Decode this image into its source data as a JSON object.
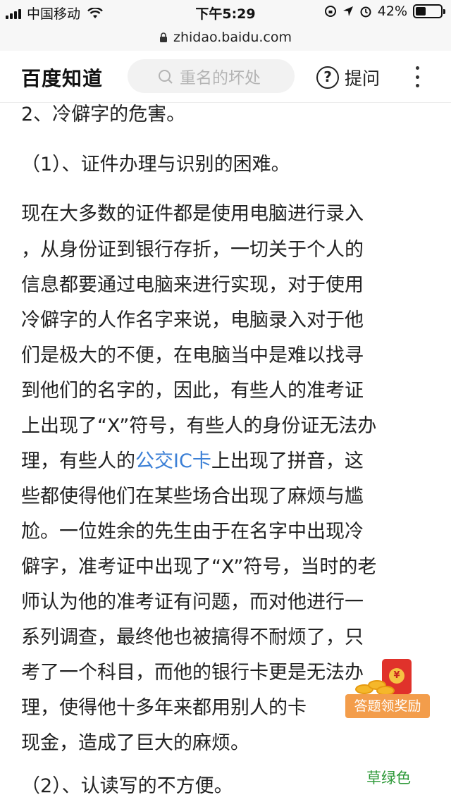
{
  "status_bar": {
    "carrier": "中国移动",
    "time": "下午5:29",
    "battery": "42%",
    "battery_level": 0.42
  },
  "url_bar": {
    "url": "zhidao.baidu.com"
  },
  "header": {
    "logo": "百度知道",
    "search_text": "重名的坏处",
    "ask_label": "提问",
    "ask_glyph": "?"
  },
  "content": {
    "lines": [
      "2、冷僻字的危害。",
      "（1）、证件办理与识别的困难。",
      "现在大多数的证件都是使用电脑进行录入",
      "，从身份证到银行存折，一切关于个人的",
      "信息都要通过电脑来进行实现，对于使用",
      "冷僻字的人作名字来说，电脑录入对于他",
      "们是极大的不便，在电脑当中是难以找寻",
      "到他们的名字的，因此，有些人的准考证",
      "上出现了“X”符号，有些人的身份证无法办",
      "理，有些人的",
      "些都使得他们在某些场合出现了麻烦与尴",
      "尬。一位姓余的先生由于在名字中出现冷",
      "僻字，准考证中出现了“X”符号，当时的老",
      "师认为他的准考证有问题，而对他进行一",
      "系列调查，最终他也被搞得不耐烦了，只",
      "考了一个科目，而他的银行卡更是无法办",
      "理，使得他十多年来都用别人的卡",
      "现金，造成了巨大的麻烦。",
      "（2）、认读写的不方便。"
    ],
    "link_text": "公交IC卡",
    "link_suffix": "上出现了拼音，这"
  },
  "reward": {
    "label": "答题领奖励",
    "seal": "¥"
  },
  "bottom_tag": "草绿色"
}
